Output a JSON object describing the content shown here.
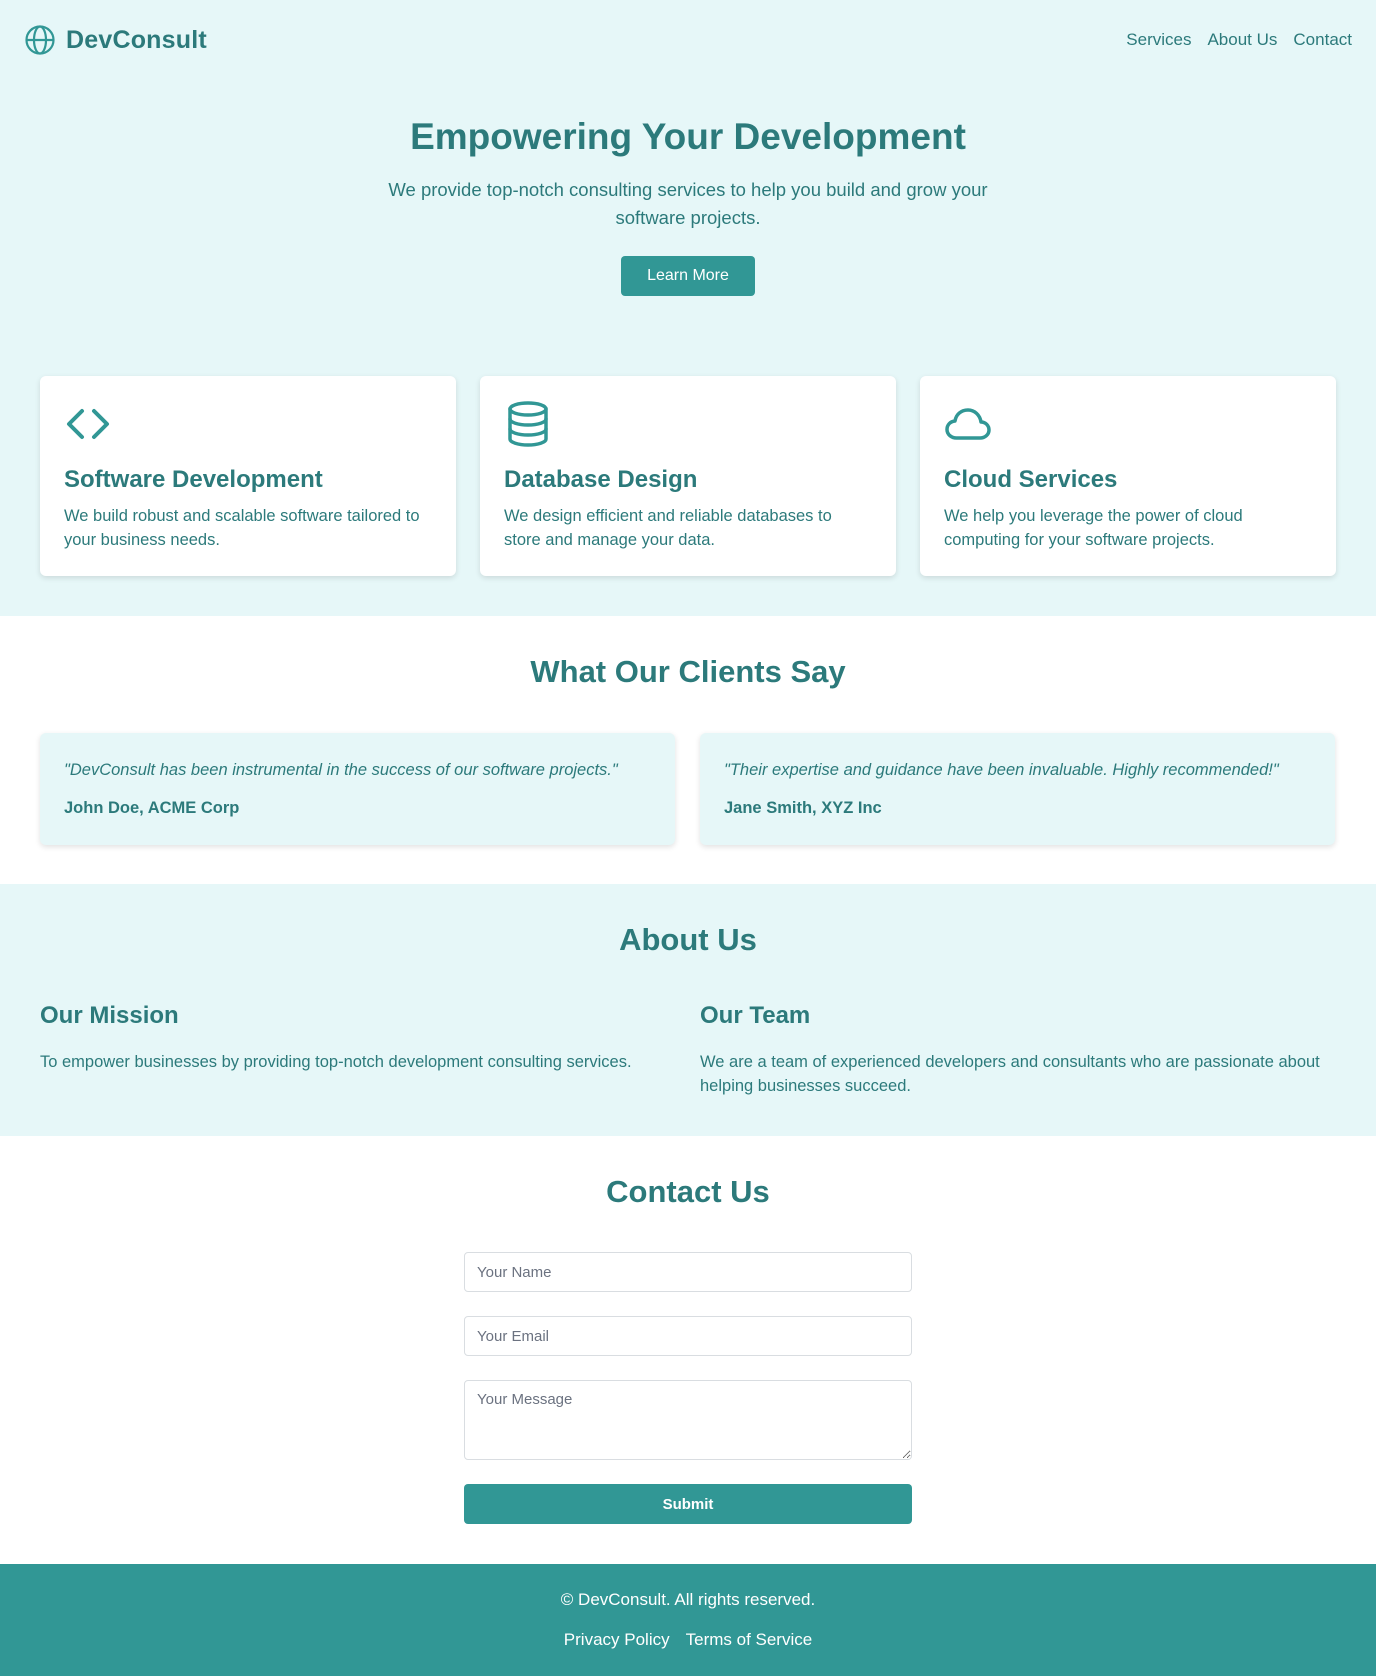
{
  "brand": {
    "name": "DevConsult",
    "icon": "globe-icon"
  },
  "nav": {
    "items": [
      "Services",
      "About Us",
      "Contact"
    ]
  },
  "hero": {
    "title": "Empowering Your Development",
    "subtitle": "We provide top-notch consulting services to help you build and grow your software projects.",
    "cta_label": "Learn More"
  },
  "services": [
    {
      "icon": "code-icon",
      "title": "Software Development",
      "description": "We build robust and scalable software tailored to your business needs."
    },
    {
      "icon": "database-icon",
      "title": "Database Design",
      "description": "We design efficient and reliable databases to store and manage your data."
    },
    {
      "icon": "cloud-icon",
      "title": "Cloud Services",
      "description": "We help you leverage the power of cloud computing for your software projects."
    }
  ],
  "testimonials": {
    "title": "What Our Clients Say",
    "items": [
      {
        "quote": "\"DevConsult has been instrumental in the success of our software projects.\"",
        "author": "John Doe, ACME Corp"
      },
      {
        "quote": "\"Their expertise and guidance have been invaluable. Highly recommended!\"",
        "author": "Jane Smith, XYZ Inc"
      }
    ]
  },
  "about": {
    "title": "About Us",
    "mission": {
      "title": "Our Mission",
      "text": "To empower businesses by providing top-notch development consulting services."
    },
    "team": {
      "title": "Our Team",
      "text": "We are a team of experienced developers and consultants who are passionate about helping businesses succeed."
    }
  },
  "contact": {
    "title": "Contact Us",
    "name_placeholder": "Your Name",
    "email_placeholder": "Your Email",
    "message_placeholder": "Your Message",
    "submit_label": "Submit"
  },
  "footer": {
    "copyright": "© DevConsult. All rights reserved.",
    "links": [
      "Privacy Policy",
      "Terms of Service"
    ]
  },
  "colors": {
    "primary": "#319795",
    "text": "#2c7a7b",
    "background_tint": "#e6f7f8",
    "white": "#ffffff"
  }
}
